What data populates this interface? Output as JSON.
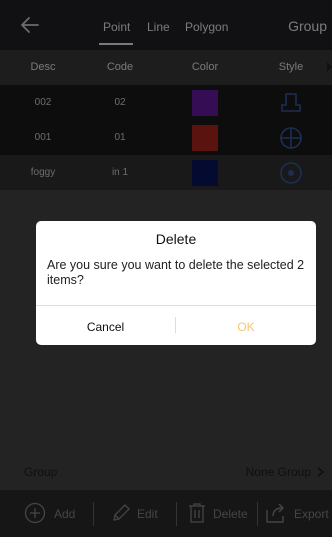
{
  "topbar": {
    "tabs": [
      "Point",
      "Line",
      "Polygon"
    ],
    "group_title": "Group"
  },
  "table": {
    "columns": [
      "Desc",
      "Code",
      "Color",
      "Style"
    ],
    "rows": [
      {
        "desc": "002",
        "code": "02",
        "color": "#6a1aaa",
        "style_icon": "pedestal-icon",
        "selected": true
      },
      {
        "desc": "001",
        "code": "01",
        "color": "#b4271c",
        "style_icon": "circle-cross-icon",
        "selected": true
      },
      {
        "desc": "foggy",
        "code": "in 1",
        "color": "#0a1560",
        "style_icon": "circle-dot-icon",
        "selected": false
      }
    ]
  },
  "group_row": {
    "label": "Group",
    "value": "None Group"
  },
  "toolbar": {
    "add": "Add",
    "edit": "Edit",
    "delete": "Delete",
    "export": "Export"
  },
  "dialog": {
    "title": "Delete",
    "message": "Are you sure you want to delete the selected 2 items?",
    "cancel": "Cancel",
    "ok": "OK"
  },
  "colors": {
    "accent": "#f7c66c",
    "icon_blue": "#3a5aa8"
  }
}
